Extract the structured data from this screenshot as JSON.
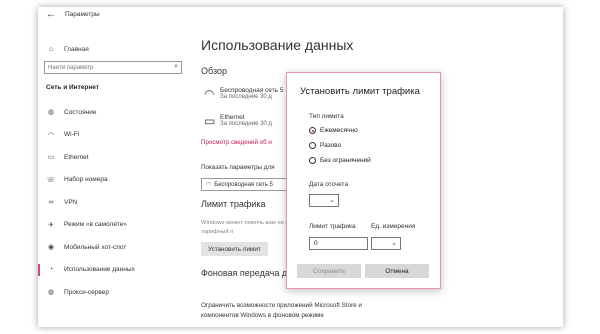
{
  "window": {
    "title": "Параметры"
  },
  "sidebar": {
    "home_label": "Главная",
    "search_placeholder": "Найти параметр",
    "section_header": "Сеть и Интернет",
    "items": [
      {
        "label": "Состояние",
        "icon": "globe-icon"
      },
      {
        "label": "Wi-Fi",
        "icon": "wifi-icon"
      },
      {
        "label": "Ethernet",
        "icon": "ethernet-icon"
      },
      {
        "label": "Набор номера",
        "icon": "phone-icon"
      },
      {
        "label": "VPN",
        "icon": "vpn-icon"
      },
      {
        "label": "Режим «в самолете»",
        "icon": "airplane-icon"
      },
      {
        "label": "Мобильный хот-спот",
        "icon": "hotspot-icon"
      },
      {
        "label": "Использование данных",
        "icon": "data-usage-icon",
        "active": true
      },
      {
        "label": "Прокси-сервер",
        "icon": "globe-icon"
      }
    ]
  },
  "main": {
    "page_title": "Использование данных",
    "overview_header": "Обзор",
    "networks": [
      {
        "name": "Беспроводная сеть 5",
        "usage": "За последние 30 д"
      },
      {
        "name": "Ethernet",
        "usage": "За последние 30 д"
      }
    ],
    "view_usage_link": "Просмотр сведений об и",
    "show_params_label": "Показать параметры для",
    "show_params_value": "Беспроводная сеть 5",
    "limit_header": "Лимит трафика",
    "limit_desc": "Windows может помочь вам не выйти за ваш тарифный п",
    "set_limit_button": "Установить лимит",
    "background_header": "Фоновая передача д",
    "background_desc": "",
    "restrict_text_line1": "Ограничить возможности приложений Microsoft Store и",
    "restrict_text_line2": "компонентов Windows в фоновом режиме"
  },
  "dialog": {
    "title": "Установить лимит трафика",
    "limit_type_label": "Тип лимита",
    "options": [
      {
        "label": "Ежемесячно",
        "checked": true
      },
      {
        "label": "Разово",
        "checked": false
      },
      {
        "label": "Без ограничений",
        "checked": false
      }
    ],
    "reset_date_label": "Дата отсчета",
    "reset_date_value": "",
    "traffic_limit_label": "Лимит трафика",
    "traffic_limit_value": "0",
    "unit_label": "Ед. измерения",
    "unit_value": "",
    "save_button": "Сохранить",
    "cancel_button": "Отмена"
  },
  "colors": {
    "accent": "#c2185b",
    "dialog_border": "#e895bc"
  }
}
